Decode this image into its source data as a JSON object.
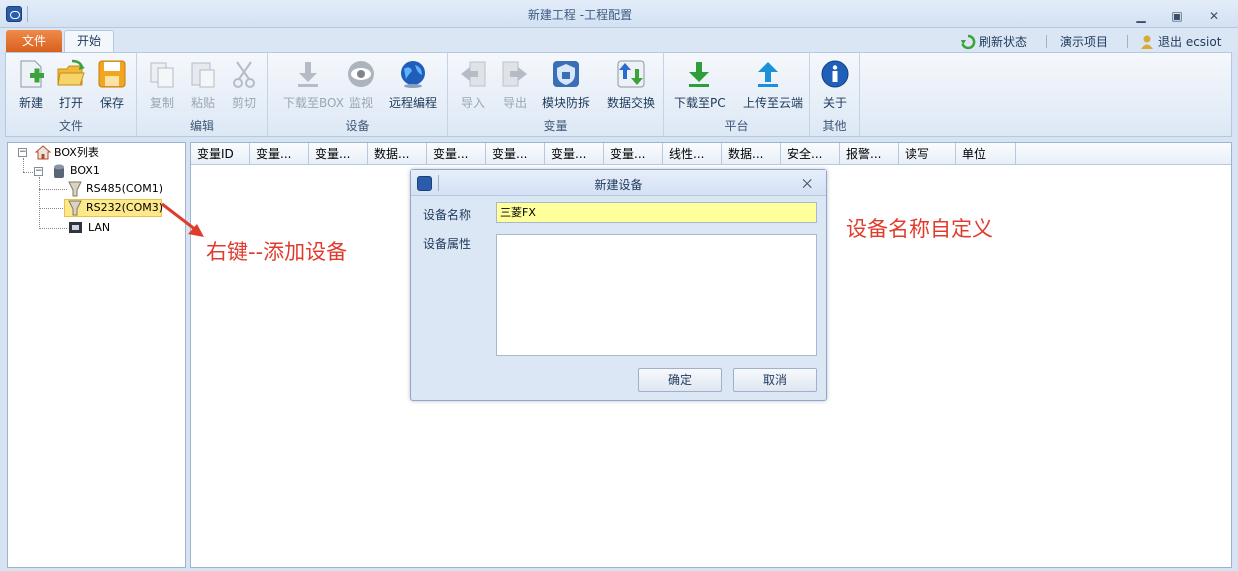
{
  "window": {
    "title": "新建工程 -工程配置"
  },
  "tabs": {
    "file": "文件",
    "start": "开始"
  },
  "quick_access": {
    "refresh": "刷新状态",
    "demo": "演示项目",
    "logout": "退出 ecsiot"
  },
  "ribbon": {
    "groups": {
      "file": "文件",
      "edit": "编辑",
      "device": "设备",
      "variable": "变量",
      "platform": "平台",
      "other": "其他"
    },
    "buttons": {
      "new": "新建",
      "open": "打开",
      "save": "保存",
      "copy": "复制",
      "paste": "粘贴",
      "cut": "剪切",
      "download_box": "下载至BOX",
      "monitor": "监视",
      "remote": "远程编程",
      "import": "导入",
      "export": "导出",
      "module_protect": "模块防拆",
      "data_exchange": "数据交换",
      "download_pc": "下载至PC",
      "upload_cloud": "上传至云端",
      "about": "关于"
    }
  },
  "tree": {
    "root": "BOX列表",
    "box": "BOX1",
    "items": [
      "RS485(COM1)",
      "RS232(COM3)",
      "LAN"
    ]
  },
  "grid": {
    "columns": [
      "变量ID",
      "变量...",
      "变量...",
      "数据...",
      "变量...",
      "变量...",
      "变量...",
      "变量...",
      "线性...",
      "数据...",
      "安全...",
      "报警...",
      "读写",
      "单位"
    ]
  },
  "annotations": {
    "right_click": "右键--添加设备",
    "custom_name": "设备名称自定义"
  },
  "dialog": {
    "title": "新建设备",
    "name_label": "设备名称",
    "name_value": "三菱FX",
    "attr_label": "设备属性",
    "ok": "确定",
    "cancel": "取消"
  },
  "colors": {
    "accent_orange": "#e06a2a",
    "annotation_red": "#e03c2e",
    "input_yellow": "#ffff9b",
    "selection": "#fde98a"
  }
}
